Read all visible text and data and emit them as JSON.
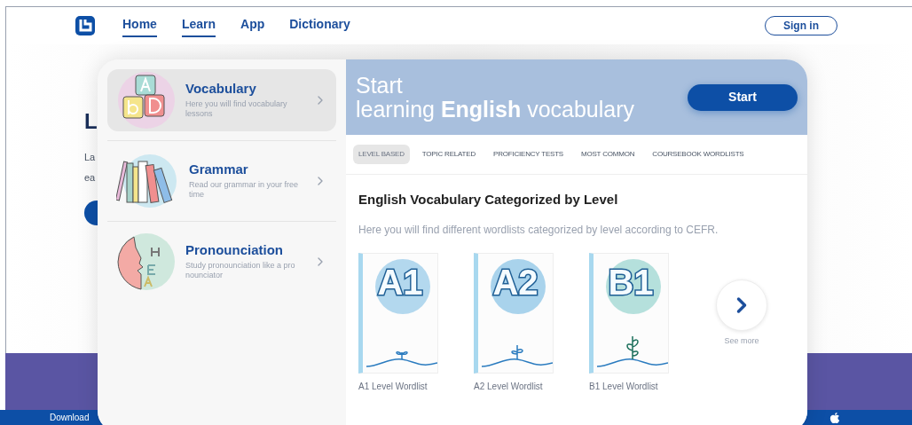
{
  "nav": {
    "links": [
      {
        "label": "Home",
        "active": true
      },
      {
        "label": "Learn",
        "active": true
      },
      {
        "label": "App",
        "active": false
      },
      {
        "label": "Dictionary",
        "active": false
      }
    ],
    "sign_in": "Sign in"
  },
  "background_page": {
    "heading": "L",
    "text_lines": [
      "La",
      "ea"
    ],
    "footer_text": "Download"
  },
  "menu": {
    "items": [
      {
        "kind": "vocabulary",
        "title": "Vocabulary",
        "subtitle": "Here you will find vocabulary lessons",
        "selected": true
      },
      {
        "kind": "grammar",
        "title": "Grammar",
        "subtitle": "Read our grammar in your free time",
        "selected": false
      },
      {
        "kind": "pronunciation",
        "title": "Pronounciation",
        "subtitle": "Study pronounciation like a pro nounciator",
        "selected": false
      }
    ]
  },
  "banner": {
    "line_1": "Start",
    "line_2": "learning **English** vocabulary",
    "button": "Start"
  },
  "tabs": [
    {
      "label": "LEVEL BASED",
      "selected": true
    },
    {
      "label": "TOPIC RELATED",
      "selected": false
    },
    {
      "label": "PROFICIENCY TESTS",
      "selected": false
    },
    {
      "label": "MOST COMMON",
      "selected": false
    },
    {
      "label": "COURSEBOOK WORDLISTS",
      "selected": false
    }
  ],
  "section": {
    "title": "English Vocabulary Categorized by Level",
    "description": "Here you will find different wordlists categorized by level according to CEFR."
  },
  "wordlists": [
    {
      "cover_text": "A1",
      "label": "A1 Level Wordlist",
      "color": "#b3d8ee"
    },
    {
      "cover_text": "A2",
      "label": "A2 Level Wordlist",
      "color": "#a9d3ec"
    },
    {
      "cover_text": "B1",
      "label": "B1 Level Wordlist",
      "color": "#b5e0dc"
    }
  ],
  "see_more": "See more"
}
